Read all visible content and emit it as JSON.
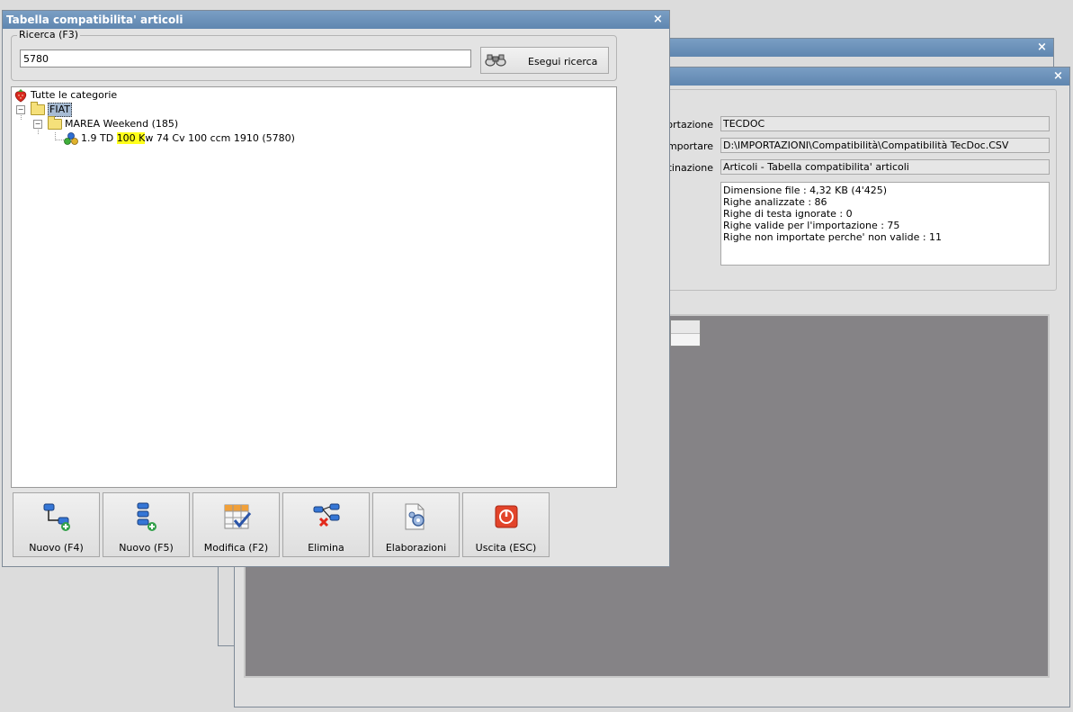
{
  "main_window": {
    "title": "Tabella compatibilita' articoli",
    "close_glyph": "×"
  },
  "search": {
    "group_label": "Ricerca (F3)",
    "value": "5780",
    "button_label": "Esegui ricerca",
    "button_icon": "binoculars-icon"
  },
  "tree": {
    "root_label": "Tutte le categorie",
    "root_icon": "strawberry-icon",
    "level1_label": "FIAT",
    "level2_label": "MAREA Weekend (185)",
    "leaf_parts": {
      "before": "1.9 TD ",
      "highlight": "100 K",
      "after": "w 74 Cv 100 ccm 1910 (5780)"
    },
    "leaf_icon": "parts-icon"
  },
  "toolbar": [
    {
      "label": "Nuovo (F4)",
      "icon": "new-branch-icon"
    },
    {
      "label": "Nuovo (F5)",
      "icon": "new-item-icon"
    },
    {
      "label": "Modifica (F2)",
      "icon": "edit-table-icon"
    },
    {
      "label": "Elimina",
      "icon": "delete-icon"
    },
    {
      "label": "Elaborazioni",
      "icon": "process-icon"
    },
    {
      "label": "Uscita (ESC)",
      "icon": "exit-icon"
    }
  ],
  "background_window": {
    "close_glyph": "×",
    "rows": [
      {
        "label": "ortazione :",
        "value": "TECDOC"
      },
      {
        "label": "mportare :",
        "value": "D:\\IMPORTAZIONI\\Compatibilità\\Compatibilità TecDoc.CSV"
      },
      {
        "label": "tinazione :",
        "value": "Articoli - Tabella compatibilita' articoli"
      }
    ],
    "report_lines": [
      "Dimensione file : 4,32 KB (4'425)",
      "Righe analizzate : 86",
      "Righe di testa ignorate : 0",
      "Righe valide per l'importazione : 75",
      "Righe non importate perche' non valide : 11"
    ]
  },
  "colors": {
    "titlebar": "#6f95bd",
    "highlight": "#ffff1a",
    "gray_area": "#858386"
  }
}
